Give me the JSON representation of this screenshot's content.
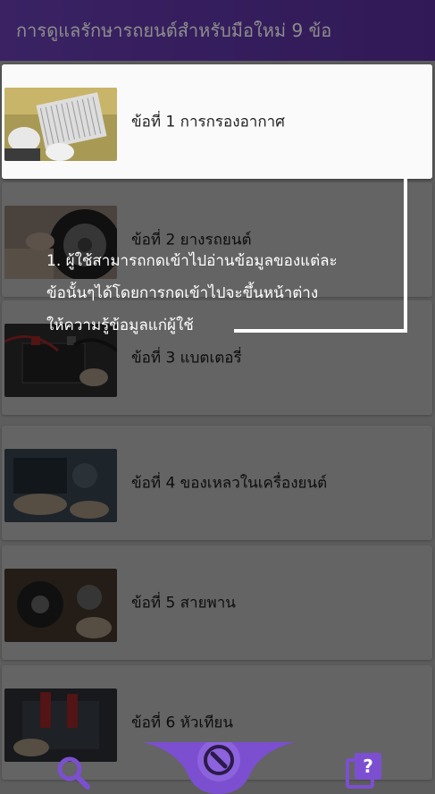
{
  "header": {
    "title": "การดูแลรักษารถยนต์สำหรับมือใหม่ 9 ข้อ"
  },
  "items": [
    {
      "label": "ข้อที่ 1 การกรองอากาศ",
      "thumb": "air-filter-thumbnail"
    },
    {
      "label": "ข้อที่ 2 ยางรถยนต์",
      "thumb": "tire-thumbnail"
    },
    {
      "label": "ข้อที่ 3 แบตเตอรี่",
      "thumb": "battery-thumbnail"
    },
    {
      "label": "ข้อที่ 4 ของเหลวในเครื่องยนต์",
      "thumb": "engine-fluid-thumbnail"
    },
    {
      "label": "ข้อที่ 5 สายพาน",
      "thumb": "belt-thumbnail"
    },
    {
      "label": "ข้อที่ 6 หัวเทียน",
      "thumb": "spark-plug-thumbnail"
    }
  ],
  "tutorial": {
    "lines": [
      "1. ผู้ใช้สามารถกดเข้าไปอ่านข้อมูลของแต่ละ",
      "ข้อนั้นๆได้โดยการกดเข้าไปจะขึ้นหน้าต่าง",
      "ให้ความรู้ข้อมูลแก่ผู้ใช้"
    ]
  },
  "bottom_nav": {
    "icons": [
      "search-icon",
      "wrench-icon",
      "quiz-icon"
    ]
  },
  "colors": {
    "header": "#5a2f9f",
    "accent": "#6a3fb5",
    "overlay": "rgba(0,0,0,0.60)"
  }
}
